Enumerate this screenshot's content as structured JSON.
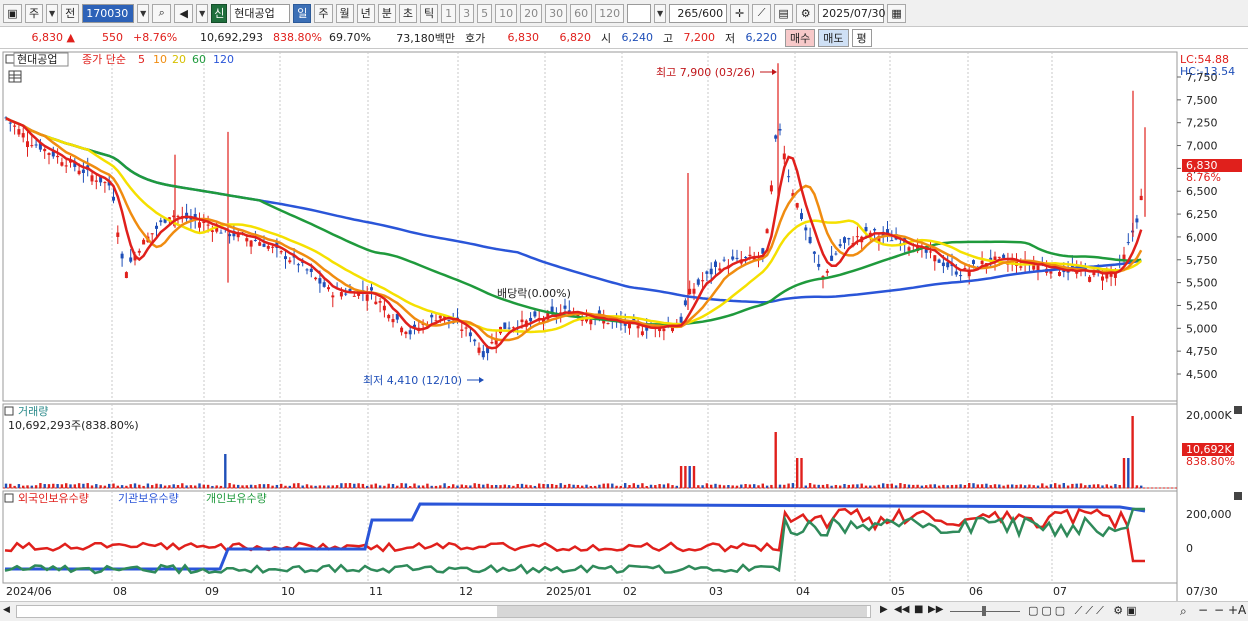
{
  "toolbar": {
    "market_type": "주",
    "period_prev": "전",
    "stock_code": "170030",
    "new_badge": "신",
    "stock_name": "현대공업",
    "periods": [
      "일",
      "주",
      "월",
      "년",
      "분",
      "초",
      "틱"
    ],
    "active_period": "일",
    "intervals": [
      "1",
      "3",
      "5",
      "10",
      "20",
      "30",
      "60",
      "120"
    ],
    "count_current": "265",
    "count_total": "/600",
    "date": "2025/07/30"
  },
  "quote": {
    "price": "6,830",
    "change": "550",
    "change_pct": "+8.76%",
    "volume": "10,692,293",
    "volume_ratio": "838.80%",
    "turnover": "69.70%",
    "amount": "73,180백만",
    "bid_label": "호가",
    "bid1": "6,830",
    "bid2": "6,820",
    "open_label": "시",
    "open": "6,240",
    "high_label": "고",
    "high": "7,200",
    "low_label": "저",
    "low": "6,220",
    "buy_button": "매수",
    "sell_button": "매도",
    "eval_button": "평"
  },
  "price_panel": {
    "stock_label": "현대공업",
    "ma_label": "종가 단순",
    "ma_periods": [
      "5",
      "10",
      "20",
      "60",
      "120"
    ],
    "ma_colors": [
      "#e0201c",
      "#f08c10",
      "#f5e000",
      "#1f9a3c",
      "#2a55d8"
    ],
    "high_annotation": "최고 7,900 (03/26)",
    "low_annotation": "최저 4,410 (12/10)",
    "dividend_annotation": "배당락(0.00%)",
    "lc_label": "LC:54.88",
    "hc_label": "HC:-13.54",
    "current_price_tag": "6,830",
    "current_pct_tag": "8.76%",
    "y_ticks": [
      "7,750",
      "7,500",
      "7,250",
      "7,000",
      "6,750",
      "6,500",
      "6,250",
      "6,000",
      "5,750",
      "5,500",
      "5,250",
      "5,000",
      "4,750",
      "4,500"
    ]
  },
  "volume_panel": {
    "title": "거래량",
    "value": "10,692,293주(838.80%)",
    "y_top": "20,000K",
    "tag_value": "10,692K",
    "tag_pct": "838.80%"
  },
  "holding_panel": {
    "series": [
      "외국인보유수량",
      "기관보유수량",
      "개인보유수량"
    ],
    "series_colors": [
      "#e0201c",
      "#2a55d8",
      "#1f9a3c"
    ],
    "y_ticks": [
      "200,000",
      "0"
    ]
  },
  "x_axis": [
    "2024/06",
    "08",
    "09",
    "10",
    "11",
    "12",
    "2025/01",
    "02",
    "03",
    "04",
    "05",
    "06",
    "07"
  ],
  "x_axis_right": "07/30"
}
